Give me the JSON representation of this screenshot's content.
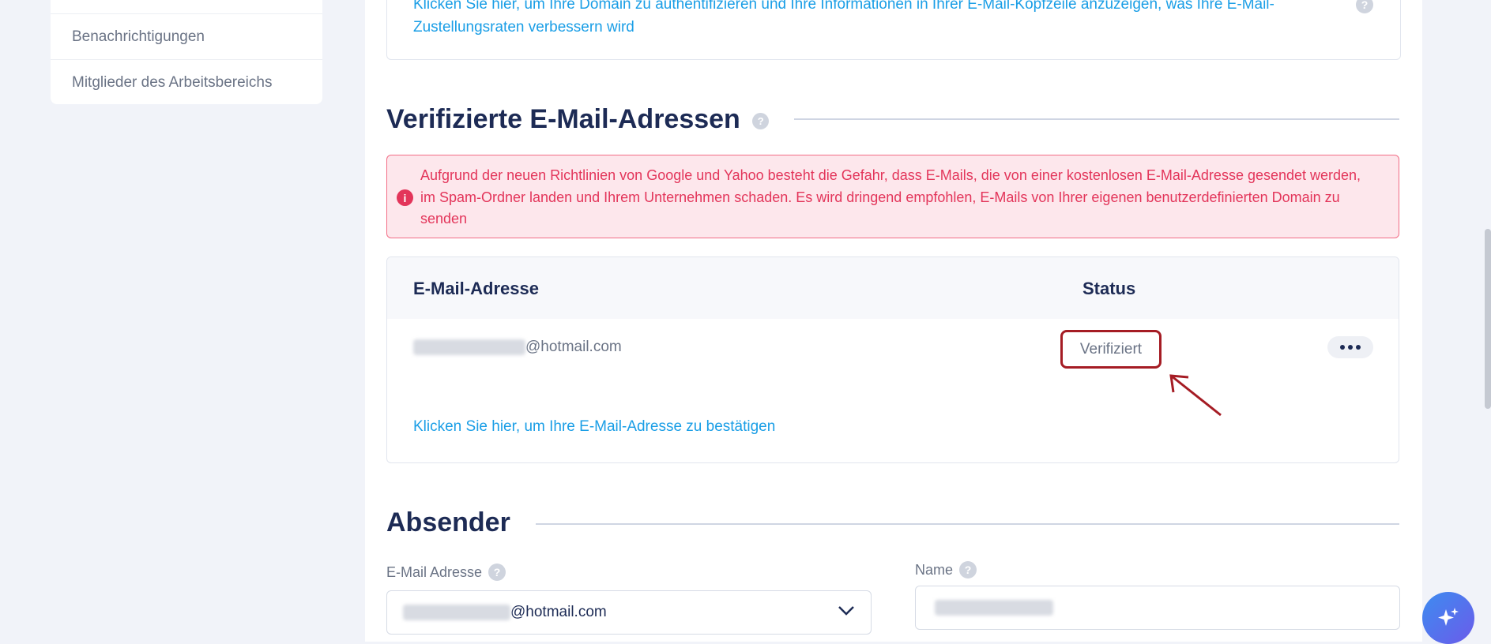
{
  "sidebar": {
    "items": [
      {
        "label": "Benachrichtigungen"
      },
      {
        "label": "Mitglieder des Arbeitsbereichs"
      }
    ]
  },
  "domain_notice": {
    "link_text": "Klicken Sie hier, um Ihre Domain zu authentifizieren und Ihre Informationen in Ihrer E-Mail-Kopfzeile anzuzeigen, was Ihre E-Mail-Zustellungsraten verbessern wird",
    "help": "?"
  },
  "verified_section": {
    "title": "Verifizierte E-Mail-Adressen",
    "help": "?",
    "alert": {
      "icon": "info-icon",
      "text": "Aufgrund der neuen Richtlinien von Google und Yahoo besteht die Gefahr, dass E-Mails, die von einer kostenlosen E-Mail-Adresse gesendet werden, im Spam-Ordner landen und Ihrem Unternehmen schaden. Es wird dringend empfohlen, E-Mails von Ihrer eigenen benutzerdefinierten Domain zu senden",
      "color": "#e3355a"
    },
    "table": {
      "headers": {
        "email": "E-Mail-Adresse",
        "status": "Status"
      },
      "rows": [
        {
          "email_domain": "@hotmail.com",
          "status": "Verifiziert"
        }
      ],
      "verify_link": "Klicken Sie hier, um Ihre E-Mail-Adresse zu bestätigen"
    }
  },
  "sender_section": {
    "title": "Absender",
    "email_label": "E-Mail Adresse",
    "email_value_domain": "@hotmail.com",
    "name_label": "Name",
    "help": "?"
  },
  "colors": {
    "accent_link": "#1a9ee6",
    "heading": "#1d2b55",
    "highlight": "#a51c24"
  }
}
